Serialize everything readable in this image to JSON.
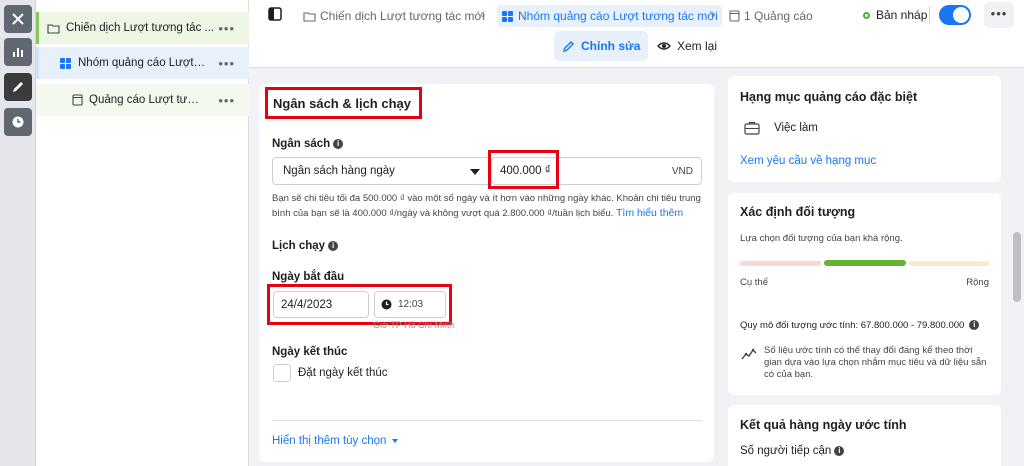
{
  "rail": {
    "items": [
      {
        "name": "close-icon"
      },
      {
        "name": "bar-chart-icon"
      },
      {
        "name": "pencil-icon"
      },
      {
        "name": "clock-icon"
      }
    ]
  },
  "tree": {
    "campaign": "Chiến dịch Lượt tương tác ...",
    "adset": "Nhóm quảng cáo Lượt t...",
    "ad": "Quảng cáo Lượt tươn...",
    "more": "•••"
  },
  "breadcrumb": {
    "campaign": "Chiến dịch Lượt tương tác mới",
    "adset": "Nhóm quảng cáo Lượt tương tác mới",
    "ad": "1 Quảng cáo"
  },
  "status": {
    "label": "Bản nháp",
    "color": "#42b72a"
  },
  "modes": {
    "edit": "Chỉnh sửa",
    "review": "Xem lại"
  },
  "budget_schedule": {
    "title": "Ngân sách & lịch chạy",
    "budget_label": "Ngân sách",
    "budget_type": "Ngân sách hàng ngày",
    "budget_amount": "400.000 ₫",
    "currency": "VND",
    "note": "Bạn sẽ chi tiêu tối đa 500.000 ₫ vào một số ngày và ít hơn vào những ngày khác. Khoản chi tiêu trung bình của bạn sẽ là 400.000 ₫/ngày và không vượt quá 2.800.000 ₫/tuần lịch biểu.",
    "note_link": "Tìm hiểu thêm",
    "schedule_label": "Lịch chạy",
    "start_label": "Ngày bắt đầu",
    "start_date": "24/4/2023",
    "start_time": "12:03",
    "timezone": "Giờ TP Hồ Chí Minh",
    "end_label": "Ngày kết thúc",
    "end_checkbox": "Đặt ngày kết thúc",
    "more_options": "Hiển thị thêm tùy chọn"
  },
  "special_category": {
    "title": "Hạng mục quảng cáo đặc biệt",
    "item": "Việc làm",
    "link": "Xem yêu cầu về hạng mục"
  },
  "audience": {
    "title": "Xác định đối tượng",
    "desc": "Lựa chọn đối tượng của bạn khá rộng.",
    "left": "Cụ thể",
    "right": "Rộng",
    "size": "Quy mô đối tượng ước tính: 67.800.000 - 79.800.000",
    "disclaimer": "Số liệu ước tính có thể thay đổi đáng kể theo thời gian dựa vào lựa chọn nhắm mục tiêu và dữ liệu sẵn có của bạn."
  },
  "daily_results": {
    "title": "Kết quả hàng ngày ước tính",
    "reach_label": "Số người tiếp cận"
  },
  "colors": {
    "accent": "#1877f2",
    "highlight_box": "#e60012",
    "gauge_green": "#66b32e"
  }
}
